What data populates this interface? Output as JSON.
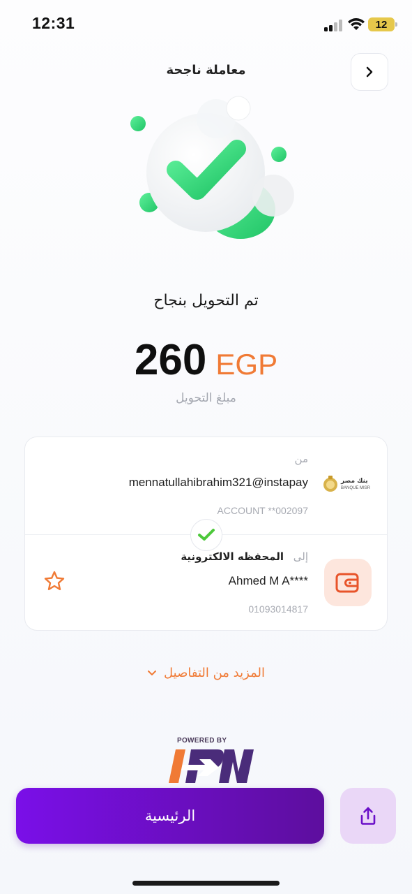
{
  "status_bar": {
    "time": "12:31",
    "battery": "12"
  },
  "header": {
    "title": "معاملة ناجحة"
  },
  "result": {
    "title": "تم التحويل بنجاح",
    "amount": "260",
    "currency": "EGP",
    "amount_label": "مبلغ التحويل"
  },
  "transfer": {
    "from": {
      "label": "من",
      "handle": "mennatullahibrahim321@instapay",
      "account": "ACCOUNT  **002097",
      "bank_logo_text": "بنك مصر",
      "bank_logo_subtext": "BANQUE MISR"
    },
    "to": {
      "label": "إلى",
      "wallet_type": "المحفظه الالكترونية",
      "name": "Ahmed M A****",
      "number": "01093014817"
    }
  },
  "more_details": {
    "label": "المزيد من التفاصيل"
  },
  "powered_by": {
    "label": "POWERED BY"
  },
  "actions": {
    "home_label": "الرئيسية"
  },
  "colors": {
    "accent": "#f07a35",
    "primary": "#6a0fc8",
    "success": "#2fd37a"
  }
}
